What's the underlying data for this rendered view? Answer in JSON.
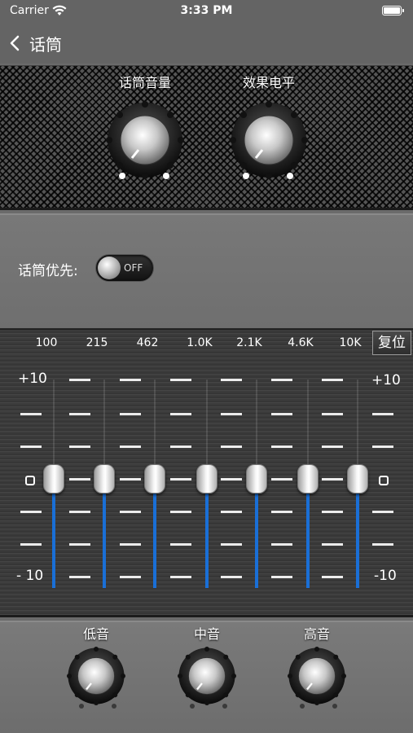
{
  "status_bar": {
    "carrier": "Carrier",
    "time": "3:33 PM"
  },
  "nav": {
    "back_label": "话筒"
  },
  "top_knobs": [
    {
      "label": "话筒音量"
    },
    {
      "label": "效果电平"
    }
  ],
  "priority": {
    "label": "话筒优先:",
    "toggle_state": "OFF"
  },
  "eq": {
    "reset_label": "复位",
    "bands": [
      {
        "label": "100",
        "value": 0
      },
      {
        "label": "215",
        "value": 0
      },
      {
        "label": "462",
        "value": 0
      },
      {
        "label": "1.0K",
        "value": 0
      },
      {
        "label": "2.1K",
        "value": 0
      },
      {
        "label": "4.6K",
        "value": 0
      },
      {
        "label": "10K",
        "value": 0
      }
    ],
    "scale": {
      "top": "+10",
      "zero": "0",
      "bottom": "- 10",
      "top_right": "+10",
      "bottom_right": "-10"
    },
    "fill_color": "#1a6fd6"
  },
  "tone_knobs": [
    {
      "label": "低音"
    },
    {
      "label": "中音"
    },
    {
      "label": "高音"
    }
  ]
}
